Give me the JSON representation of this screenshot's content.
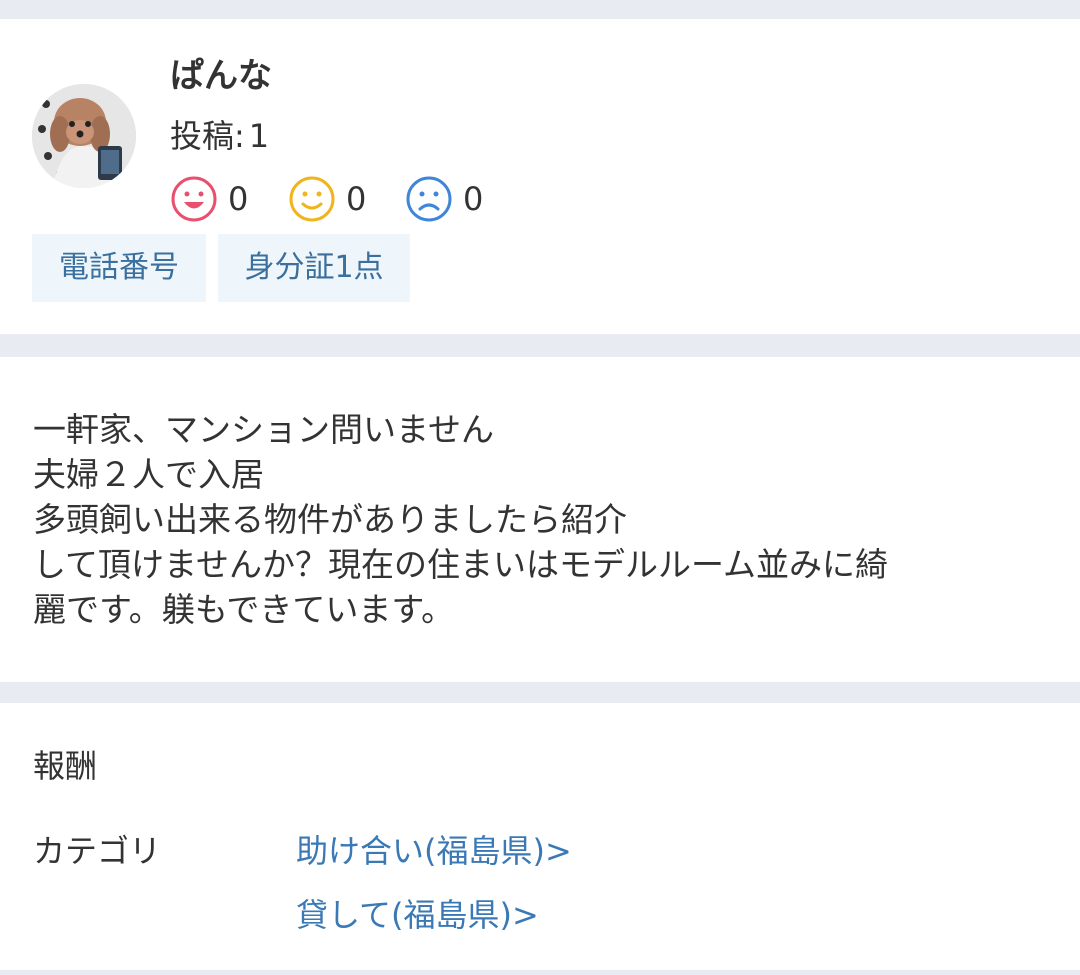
{
  "profile": {
    "username": "ぱんな",
    "posts_label": "投稿:",
    "posts_count": "1",
    "ratings": {
      "good": "0",
      "normal": "0",
      "bad": "0"
    },
    "badges": {
      "phone": "電話番号",
      "id": "身分証1点"
    },
    "rating_colors": {
      "good": "#e8506e",
      "normal": "#f0b41c",
      "bad": "#3f86d9"
    }
  },
  "post": {
    "lines": [
      "一軒家、マンション問いません",
      "夫婦２人で入居",
      "多頭飼い出来る物件がありましたら紹介",
      "して頂けませんか？現在の住まいはモデルルーム並みに綺",
      "麗です。躾もできています。"
    ]
  },
  "info": {
    "reward_label": "報酬",
    "category_label": "カテゴリ",
    "categories": [
      "助け合い(福島県)>",
      "貸して(福島県)>"
    ]
  }
}
